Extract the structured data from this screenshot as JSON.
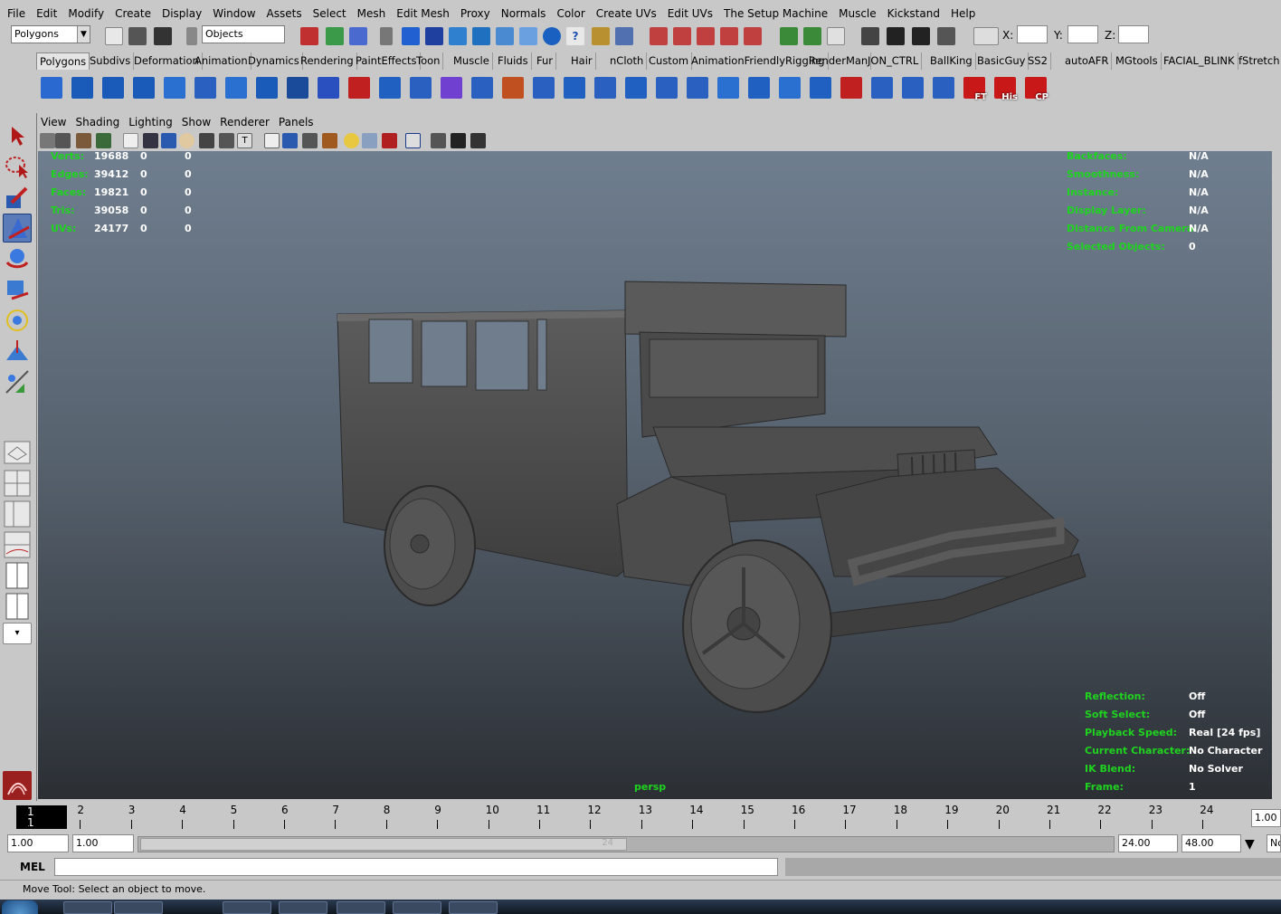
{
  "menubar": {
    "items": [
      "File",
      "Edit",
      "Modify",
      "Create",
      "Display",
      "Window",
      "Assets",
      "Select",
      "Mesh",
      "Edit Mesh",
      "Proxy",
      "Normals",
      "Color",
      "Create UVs",
      "Edit UVs",
      "The Setup Machine",
      "Muscle",
      "Kickstand",
      "Help"
    ]
  },
  "status_line": {
    "menuset": "Polygons",
    "selection_mode": "Objects",
    "x_label": "X:",
    "y_label": "Y:",
    "z_label": "Z:"
  },
  "shelf": {
    "tabs": [
      "Polygons",
      "Subdivs",
      "Deformation",
      "Animation",
      "Dynamics",
      "Rendering",
      "PaintEffects",
      "Toon",
      "Muscle",
      "Fluids",
      "Fur",
      "Hair",
      "nCloth",
      "Custom",
      "AnimationFriendlyRigging",
      "RenderMan",
      "JON_CTRL",
      "BallKing",
      "BasicGuy",
      "SS2",
      "autoAFR",
      "MGtools",
      "FACIAL_BLINK",
      "fStretch"
    ],
    "active_tab": "Polygons",
    "labeled_icons": [
      "FT",
      "His",
      "CP"
    ]
  },
  "panel_menu": [
    "View",
    "Shading",
    "Lighting",
    "Show",
    "Renderer",
    "Panels"
  ],
  "hud": {
    "poly_count": [
      {
        "label": "Verts:",
        "v1": "19688",
        "v2": "0",
        "v3": "0"
      },
      {
        "label": "Edges:",
        "v1": "39412",
        "v2": "0",
        "v3": "0"
      },
      {
        "label": "Faces:",
        "v1": "19821",
        "v2": "0",
        "v3": "0"
      },
      {
        "label": "Tris:",
        "v1": "39058",
        "v2": "0",
        "v3": "0"
      },
      {
        "label": "UVs:",
        "v1": "24177",
        "v2": "0",
        "v3": "0"
      }
    ],
    "object_details": [
      {
        "label": "Backfaces:",
        "value": "N/A"
      },
      {
        "label": "Smoothness:",
        "value": "N/A"
      },
      {
        "label": "Instance:",
        "value": "N/A"
      },
      {
        "label": "Display Layer:",
        "value": "N/A"
      },
      {
        "label": "Distance From Camera:",
        "value": "N/A"
      },
      {
        "label": "Selected Objects:",
        "value": "0"
      }
    ],
    "scene_info": [
      {
        "label": "Reflection:",
        "value": "Off"
      },
      {
        "label": "Soft Select:",
        "value": "Off"
      },
      {
        "label": "Playback Speed:",
        "value": "Real [24 fps]"
      },
      {
        "label": "Current Character:",
        "value": "No Character"
      },
      {
        "label": "IK Blend:",
        "value": "No Solver"
      },
      {
        "label": "Frame:",
        "value": "1"
      }
    ],
    "camera": "persp"
  },
  "time_slider": {
    "frames": [
      "1",
      "2",
      "3",
      "4",
      "5",
      "6",
      "7",
      "8",
      "9",
      "10",
      "11",
      "12",
      "13",
      "14",
      "15",
      "16",
      "17",
      "18",
      "19",
      "20",
      "21",
      "22",
      "23",
      "24"
    ],
    "current_frame": "1",
    "current_time_field": "1.00"
  },
  "range_slider": {
    "start_time": "1.00",
    "playback_start": "1.00",
    "range_end_label": "24",
    "playback_end": "24.00",
    "end_time": "48.00",
    "char_set": "No"
  },
  "command_line": {
    "language": "MEL"
  },
  "help_line": {
    "text": "Move Tool: Select an object to move."
  }
}
